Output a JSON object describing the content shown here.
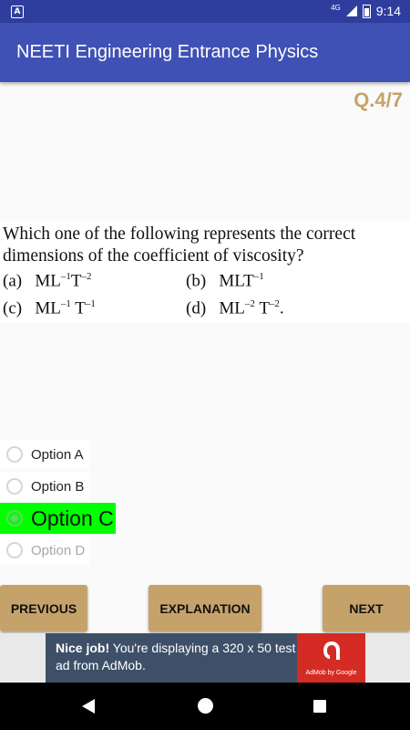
{
  "status_bar": {
    "notification_icon": "A",
    "network": "4G",
    "time": "9:14"
  },
  "app_bar": {
    "title": "NEETI Engineering Entrance Physics"
  },
  "question": {
    "number_label": "Q.4/7",
    "line1": "Which one of the following represents the correct",
    "line2": "dimensions of the coefficient of viscosity?",
    "options": {
      "a_label": "(a)",
      "a_base": "ML",
      "a_exp1": "–1",
      "a_mid": "T",
      "a_exp2": "–2",
      "b_label": "(b)",
      "b_base": "MLT",
      "b_exp1": "–1",
      "c_label": "(c)",
      "c_base": "ML",
      "c_exp1": "–1",
      "c_mid": " T",
      "c_exp2": "–1",
      "d_label": "(d)",
      "d_base": "ML",
      "d_exp1": "–2",
      "d_mid": " T",
      "d_exp2": "–2",
      "d_end": "."
    }
  },
  "answer_choices": [
    {
      "label": "Option A",
      "selected": false,
      "enabled": true
    },
    {
      "label": "Option B",
      "selected": false,
      "enabled": true
    },
    {
      "label": "Option C",
      "selected": true,
      "enabled": true
    },
    {
      "label": "Option D",
      "selected": false,
      "enabled": false
    }
  ],
  "buttons": {
    "previous": "PREVIOUS",
    "explanation": "EXPLANATION",
    "next": "NEXT"
  },
  "ad": {
    "headline": "Nice job!",
    "body": "You're displaying a 320 x 50 test ad from AdMob.",
    "caption": "AdMob by Google"
  },
  "colors": {
    "status_bar": "#2f3e9e",
    "app_bar": "#3f51b5",
    "accent_gold": "#c6a26b",
    "selected_highlight": "#00ff00",
    "ad_background": "#3d5068",
    "ad_logo": "#d52b25"
  },
  "icons": {
    "status": [
      "notification-a-icon",
      "signal-icon",
      "battery-icon"
    ],
    "nav": [
      "back-icon",
      "home-icon",
      "recents-icon"
    ]
  }
}
